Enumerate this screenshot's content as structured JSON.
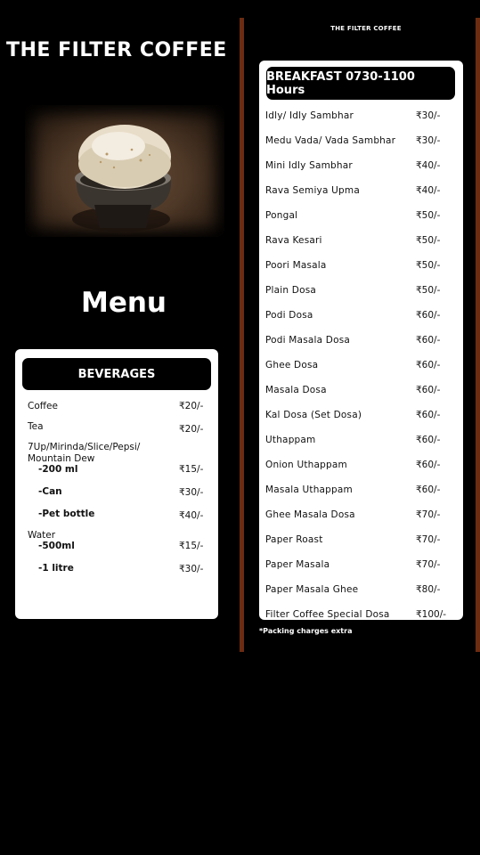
{
  "header": {
    "title": "THE FILTER COFFEE",
    "small_title": "THE FILTER COFFEE"
  },
  "menu_heading": "Menu",
  "beverages": {
    "heading": "BEVERAGES",
    "coffee": {
      "name": "Coffee",
      "price": "₹20/-"
    },
    "tea": {
      "name": "Tea",
      "price": "₹20/-"
    },
    "soft_drinks": {
      "name_line1": "7Up/Mirinda/Slice/Pepsi/",
      "name_line2": "Mountain Dew"
    },
    "sd_200": {
      "name": "-200 ml",
      "price": "₹15/-"
    },
    "sd_can": {
      "name": "-Can",
      "price": "₹30/-"
    },
    "sd_pet": {
      "name": "-Pet bottle",
      "price": "₹40/-"
    },
    "water": {
      "name": "Water"
    },
    "water_500": {
      "name": "-500ml",
      "price": "₹15/-"
    },
    "water_1l": {
      "name": "-1 litre",
      "price": "₹30/-"
    }
  },
  "breakfast": {
    "heading": "BREAKFAST 0730-1100 Hours",
    "items": [
      {
        "name": "Idly/ Idly Sambhar",
        "price": "₹30/-"
      },
      {
        "name": "Medu Vada/ Vada Sambhar",
        "price": "₹30/-"
      },
      {
        "name": "Mini Idly Sambhar",
        "price": "₹40/-"
      },
      {
        "name": "Rava Semiya Upma",
        "price": "₹40/-"
      },
      {
        "name": "Pongal",
        "price": "₹50/-"
      },
      {
        "name": "Rava Kesari",
        "price": "₹50/-"
      },
      {
        "name": "Poori Masala",
        "price": "₹50/-"
      },
      {
        "name": "Plain Dosa",
        "price": "₹50/-"
      },
      {
        "name": "Podi Dosa",
        "price": "₹60/-"
      },
      {
        "name": "Podi Masala Dosa",
        "price": "₹60/-"
      },
      {
        "name": "Ghee Dosa",
        "price": "₹60/-"
      },
      {
        "name": "Masala Dosa",
        "price": "₹60/-"
      },
      {
        "name": "Kal Dosa (Set Dosa)",
        "price": "₹60/-"
      },
      {
        "name": "Uthappam",
        "price": "₹60/-"
      },
      {
        "name": "Onion Uthappam",
        "price": "₹60/-"
      },
      {
        "name": "Masala Uthappam",
        "price": "₹60/-"
      },
      {
        "name": "Ghee Masala Dosa",
        "price": "₹70/-"
      },
      {
        "name": "Paper Roast",
        "price": "₹70/-"
      },
      {
        "name": "Paper Masala",
        "price": "₹70/-"
      },
      {
        "name": "Paper Masala Ghee",
        "price": "₹80/-"
      },
      {
        "name": "Filter Coffee Special Dosa",
        "price": "₹100/-"
      }
    ]
  },
  "footer_note": "*Packing charges extra",
  "colors": {
    "background": "#000000",
    "divider": "#6b2c12",
    "card": "#ffffff"
  },
  "image": {
    "subject": "filter-coffee-cup-photo"
  }
}
